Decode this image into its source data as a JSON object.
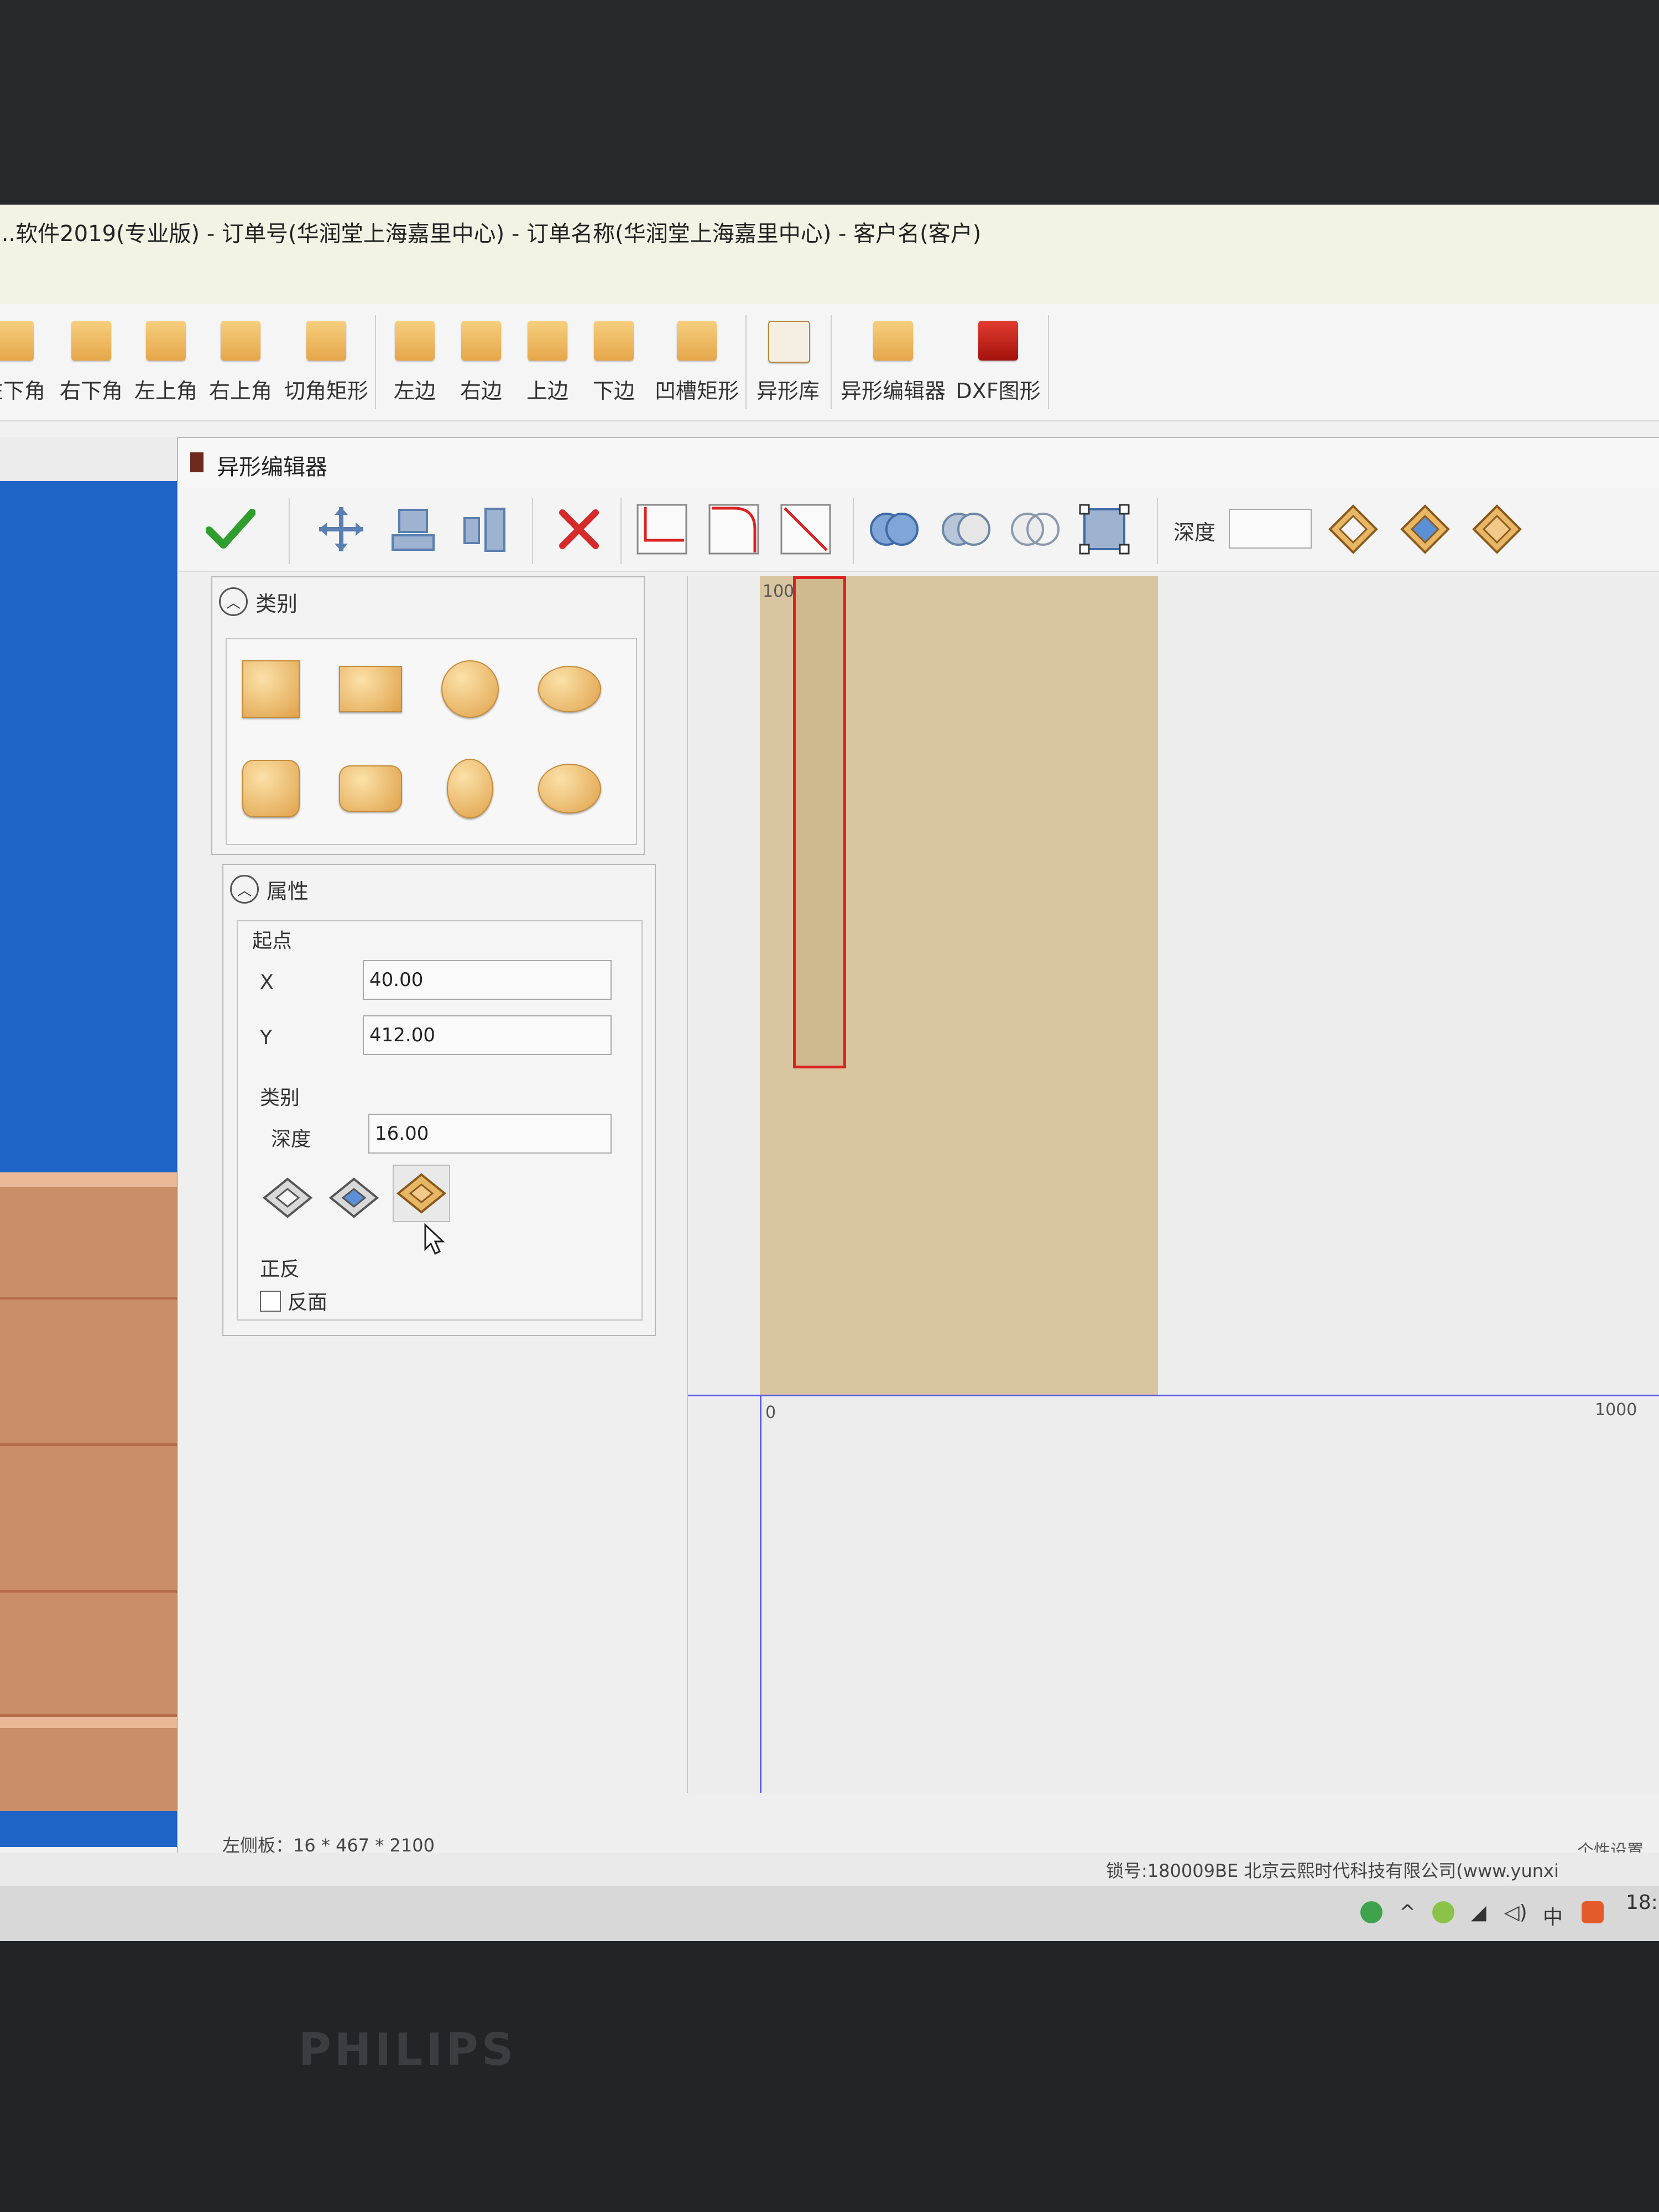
{
  "window": {
    "title": "...软件2019(专业版) - 订单号(华润堂上海嘉里中心) - 订单名称(华润堂上海嘉里中心) - 客户名(客户)"
  },
  "ribbon": {
    "buttons": [
      {
        "label": "左下角"
      },
      {
        "label": "右下角"
      },
      {
        "label": "左上角"
      },
      {
        "label": "右上角"
      },
      {
        "label": "切角矩形"
      },
      {
        "label": "左边"
      },
      {
        "label": "右边"
      },
      {
        "label": "上边"
      },
      {
        "label": "下边"
      },
      {
        "label": "凹槽矩形"
      },
      {
        "label": "异形库"
      },
      {
        "label": "异形编辑器"
      },
      {
        "label": "DXF图形"
      }
    ]
  },
  "dialog": {
    "title": "异形编辑器",
    "toolbar": {
      "depth_label": "深度",
      "depth_value": ""
    },
    "category": {
      "title": "类别",
      "shapes": [
        "square",
        "rectangle",
        "circle",
        "ellipse",
        "rounded-square",
        "rounded-rectangle",
        "vertical-ellipse",
        "horizontal-ellipse"
      ]
    },
    "properties": {
      "title": "属性",
      "start_point_label": "起点",
      "x_label": "X",
      "x_value": "40.00",
      "y_label": "Y",
      "y_value": "412.00",
      "type_label": "类别",
      "depth_label": "深度",
      "depth_value": "16.00",
      "orientation_label": "正反",
      "reverse_label": "反面",
      "reverse_checked": false
    },
    "canvas": {
      "x_origin_label": "0",
      "x_max_label": "1000",
      "y_top_label": "100"
    },
    "status": "左侧板：16 * 467 * 2100",
    "settings_link": "个性设置"
  },
  "footer": {
    "text": "锁号:180009BE 北京云熙时代科技有限公司(www.yunxi"
  },
  "taskbar": {
    "ime": "中",
    "clock": "18:"
  },
  "monitor": {
    "brand": "PHILIPS"
  },
  "colors": {
    "accent_orange": "#e6a64a",
    "part_outline": "#dd2222",
    "board": "#d9c5a0",
    "axis": "#5a5aea"
  }
}
